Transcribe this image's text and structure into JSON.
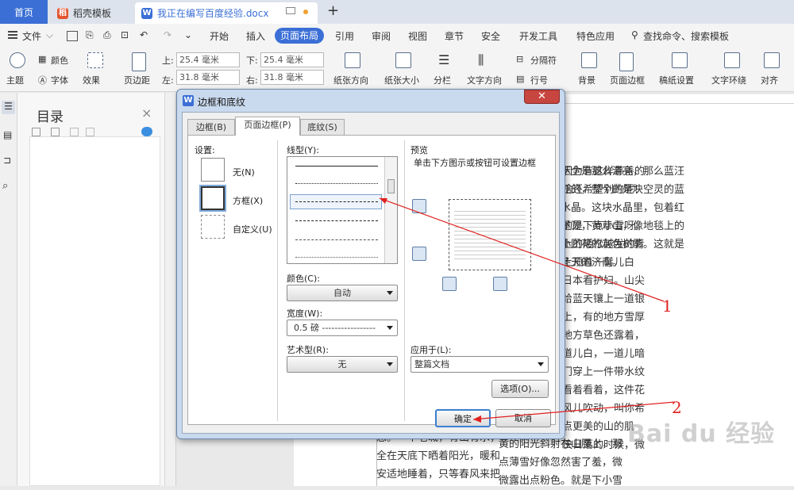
{
  "tabs": {
    "home": "首页",
    "template": "稻壳模板",
    "document": "我正在编写百度经验.docx",
    "new_tab": "+"
  },
  "menu": {
    "file": "文件",
    "items": [
      "开始",
      "插入",
      "页面布局",
      "引用",
      "审阅",
      "视图",
      "章节",
      "安全",
      "开发工具",
      "特色应用"
    ],
    "active": "页面布局",
    "search": "查找命令、搜索模板"
  },
  "ribbon": {
    "theme": "主题",
    "color": "颜色",
    "font": "字体",
    "effect": "效果",
    "margin": "页边距",
    "top_label": "上:",
    "top_value": "25.4 毫米",
    "bottom_label": "下:",
    "bottom_value": "25.4 毫米",
    "left_label": "左:",
    "left_value": "31.8 毫米",
    "right_label": "右:",
    "right_value": "31.8 毫米",
    "orientation": "纸张方向",
    "size": "纸张大小",
    "columns": "分栏",
    "text_direction": "文字方向",
    "breaks": "分隔符",
    "line_numbers": "行号",
    "background": "背景",
    "page_border": "页面边框",
    "grid_paper": "稿纸设置",
    "wrap": "文字环绕",
    "align": "对齐"
  },
  "toc": {
    "title": "目录",
    "close": "×"
  },
  "dialog": {
    "title": "边框和底纹",
    "close": "✕",
    "tabs": [
      "边框(B)",
      "页面边框(P)",
      "底纹(S)"
    ],
    "active_tab": "页面边框(P)",
    "setting_label": "设置:",
    "settings": [
      "无(N)",
      "方框(X)",
      "自定义(U)"
    ],
    "style_label": "线型(Y):",
    "color_label": "颜色(C):",
    "color_value": "自动",
    "width_label": "宽度(W):",
    "width_value": "0.5  磅 -----------------",
    "art_label": "艺术型(R):",
    "art_value": "无",
    "preview_label": "预览",
    "preview_hint": "单击下方图示或按钮可设置边框",
    "apply_label": "应用于(L):",
    "apply_value": "整篇文档",
    "options_button": "选项(O)...",
    "ok_button": "确定",
    "cancel_button": "取消"
  },
  "annotations": {
    "one": "1",
    "two": "2"
  },
  "document": {
    "col1": [
      "因为有这样慈善的",
      "啥还希望别的呢!",
      "",
      "的是下点小雪呀。",
      "上的矮松越发的青",
      "上顶着一髻儿白",
      "日本看护妇。山尖",
      "给蓝天镶上一道银",
      "上，有的地方雪厚",
      "地方草色还露着，",
      "道儿白，一道儿暗",
      "门穿上一件带水纹",
      "看着看着，这件花",
      "风儿吹动，叫你希",
      "点更美的山的肌",
      "快日落的时候，微",
      "黄的阳光斜射在山腰上，那",
      "点薄雪好像忽然害了羞，微",
      "微露出点粉色。就是下小雪"
    ],
    "col2": [
      "下全是那么清亮，那么蓝汪",
      "汪的，整个的是块空灵的蓝",
      "水晶。这块水晶里，包着红",
      "屋顶，黄草山，像地毯上的",
      "小团花的灰色树影。这就是",
      "冬天的济南。"
    ],
    "bottom_left": [
      "息。一个老城，有山有水，",
      "全在天底下晒着阳光，暖和",
      "安适地睡着，只等春风来把"
    ]
  },
  "watermark": "Bai du 经验"
}
